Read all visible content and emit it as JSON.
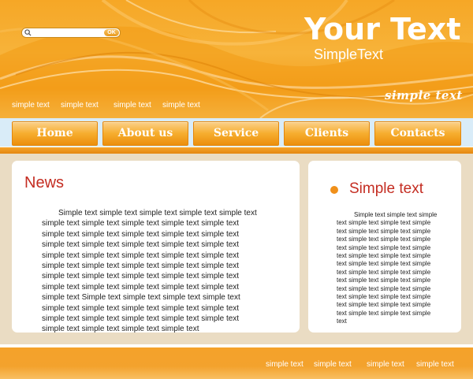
{
  "colors": {
    "brand_orange": "#f6a726",
    "headline_red": "#c42d22",
    "nav_band": "#d9ecf8",
    "content_bg": "#eadcc3",
    "bullet": "#f0901a"
  },
  "header": {
    "title": "Your Text",
    "subtitle": "SimpleText",
    "tagline": "simple text",
    "search": {
      "placeholder": "",
      "button_label": "OK",
      "icon": "search-icon"
    },
    "links": [
      "simple text",
      "simple text",
      "simple text",
      "simple text"
    ]
  },
  "nav": {
    "items": [
      {
        "label": "Home"
      },
      {
        "label": "About us"
      },
      {
        "label": "Service"
      },
      {
        "label": "Clients"
      },
      {
        "label": "Contacts"
      }
    ]
  },
  "main": {
    "title": "News",
    "text": "Simple text simple text simple text simple text simple text simple text simple text simple text simple text simple text simple text simple text simple text simple text simple text simple text simple text simple text simple text simple text simple text simple text simple text simple text simple text simple text simple text simple text simple text simple text simple text simple text simple text simple text simple text simple text simple text simple text simple text simple text simple text Simple text simple text simple text simple text simple text simple text simple text simple text simple text simple text simple text simple text simple text simple text simple text simple text simple text simple text"
  },
  "sidebar": {
    "title": "Simple text",
    "text": "Simple text simple text simple text simple text simple text simple text simple text simple text simple text simple text simple text simple text simple text simple text simple text simple text simple text simple text simple text simple text simple text simple text simple text simple text simple text simple text simple text simple text simple text simple text simple text simple text simple text simple text simple text simple text simple text simple text simple text"
  },
  "footer": {
    "links": [
      "simple text",
      "simple text",
      "simple text",
      "simple text"
    ]
  }
}
